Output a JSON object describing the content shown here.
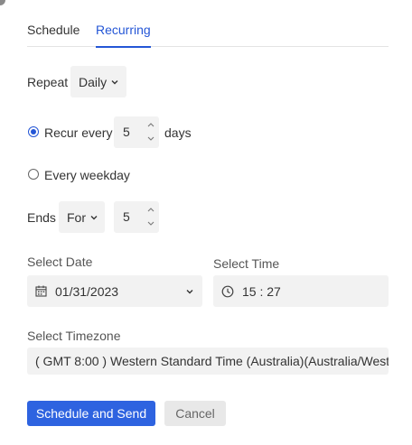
{
  "tabs": [
    {
      "label": "Schedule",
      "active": false
    },
    {
      "label": "Recurring",
      "active": true
    }
  ],
  "repeat": {
    "label": "Repeat",
    "value": "Daily"
  },
  "recur_every": {
    "label": "Recur every",
    "value": "5",
    "unit": "days",
    "selected": true
  },
  "every_weekday": {
    "label": "Every weekday",
    "selected": false
  },
  "ends": {
    "label": "Ends",
    "mode": "For",
    "count": "5"
  },
  "select_date": {
    "label": "Select Date",
    "value": "01/31/2023"
  },
  "select_time": {
    "label": "Select Time",
    "value": "15 : 27"
  },
  "select_timezone": {
    "label": "Select Timezone",
    "value": "( GMT 8:00 ) Western Standard Time (Australia)(Australia/West"
  },
  "buttons": {
    "primary": "Schedule and Send",
    "secondary": "Cancel"
  },
  "colors": {
    "accent": "#2456d6",
    "button_primary": "#2e63e0",
    "field_bg": "#f2f2f2"
  },
  "icons": {
    "calendar": "calendar-icon",
    "clock": "clock-icon",
    "chevron": "chevron-down-icon",
    "spinner_up": "caret-up-icon",
    "spinner_down": "caret-down-icon"
  }
}
